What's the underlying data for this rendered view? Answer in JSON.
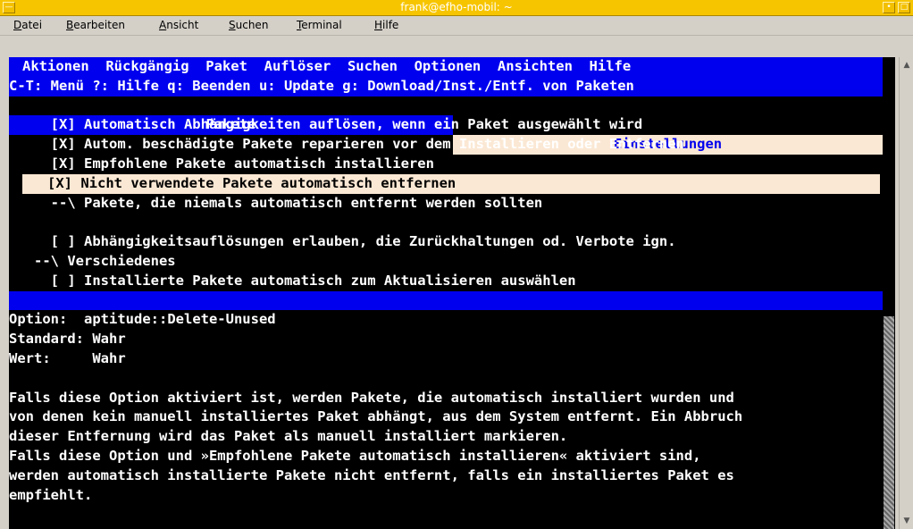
{
  "window": {
    "title": "frank@efho-mobil: ~"
  },
  "menubar": {
    "items": [
      "Datei",
      "Bearbeiten",
      "Ansicht",
      "Suchen",
      "Terminal",
      "Hilfe"
    ]
  },
  "aptitude": {
    "menu": "Aktionen  Rückgängig  Paket  Auflöser  Suchen  Optionen  Ansichten  Hilfe",
    "status": "C-T: Menü ?: Hilfe q: Beenden u: Update g: Download/Inst./Entf. von Paketen",
    "tabs": [
      "Pakete",
      "Einstellungen"
    ],
    "options": [
      "     [X] Automatisch Abhängigkeiten auflösen, wenn ein Paket ausgewählt wird",
      "     [X] Autom. beschädigte Pakete reparieren vor dem Installieren oder Entfernen",
      "     [X] Empfohlene Pakete automatisch installieren",
      "     [X] Nicht verwendete Pakete automatisch entfernen",
      "     --\\ Pakete, die niemals automatisch entfernt werden sollten",
      "",
      "     [ ] Abhängigkeitsauflösungen erlauben, die Zurückhaltungen od. Verbote ign.",
      "   --\\ Verschiedenes",
      "     [ ] Installierte Pakete automatisch zum Aktualisieren auswählen"
    ],
    "selected_option_index": 3,
    "detail": {
      "option_label": "Option:",
      "option_value": "aptitude::Delete-Unused",
      "default_label": "Standard:",
      "default_value": "Wahr",
      "value_label": "Wert:",
      "value_value": "Wahr",
      "description": [
        "Falls diese Option aktiviert ist, werden Pakete, die automatisch installiert wurden und",
        "von denen kein manuell installiertes Paket abhängt, aus dem System entfernt. Ein Abbruch",
        "dieser Entfernung wird das Paket als manuell installiert markieren.",
        "Falls diese Option und »Empfohlene Pakete automatisch installieren« aktiviert sind,",
        "werden automatisch installierte Pakete nicht entfernt, falls ein installiertes Paket es",
        "empfiehlt."
      ]
    }
  },
  "colors": {
    "titlebar": "#f7c500",
    "aptitude_blue": "#0000ee",
    "highlight": "#fbe8d4",
    "terminal_bg": "#000000"
  }
}
